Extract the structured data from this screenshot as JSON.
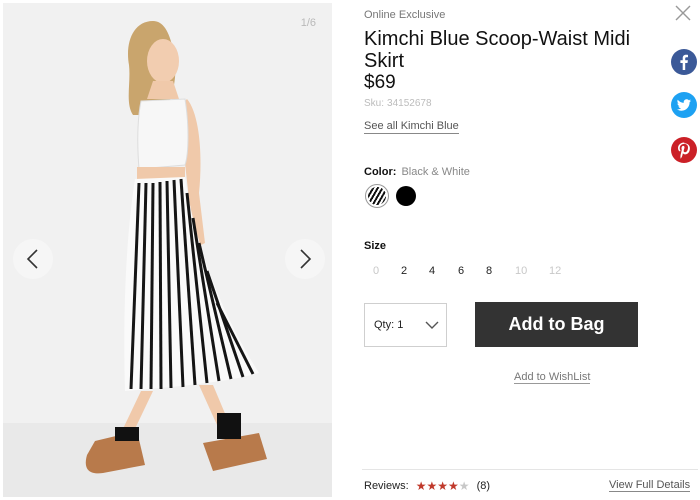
{
  "gallery": {
    "counter": "1/6",
    "prev_icon": "chevron-left-icon",
    "next_icon": "chevron-right-icon"
  },
  "product": {
    "eyebrow": "Online Exclusive",
    "title": "Kimchi Blue Scoop-Waist Midi Skirt",
    "price": "$69",
    "sku_label": "Sku:",
    "sku_value": "34152678",
    "see_all": "See all Kimchi Blue"
  },
  "color": {
    "label": "Color:",
    "selected": "Black & White",
    "swatches": [
      "Black & White",
      "Black"
    ]
  },
  "size": {
    "label": "Size",
    "options": [
      {
        "label": "0",
        "available": false
      },
      {
        "label": "2",
        "available": true
      },
      {
        "label": "4",
        "available": true
      },
      {
        "label": "6",
        "available": true
      },
      {
        "label": "8",
        "available": true
      },
      {
        "label": "10",
        "available": false
      },
      {
        "label": "12",
        "available": false
      }
    ]
  },
  "purchase": {
    "qty_label": "Qty: 1",
    "add_to_bag": "Add to Bag",
    "wishlist": "Add to WishList"
  },
  "reviews": {
    "label": "Reviews:",
    "rating": 4,
    "max": 5,
    "count": "(8)",
    "view_full": "View Full Details"
  },
  "colors": {
    "facebook": "#3b5998",
    "twitter": "#1da1f2",
    "pinterest": "#cb2027",
    "button": "#333333",
    "star": "#c0392b"
  },
  "icons": [
    "close-icon",
    "facebook-icon",
    "twitter-icon",
    "pinterest-icon",
    "chevron-down-icon"
  ]
}
